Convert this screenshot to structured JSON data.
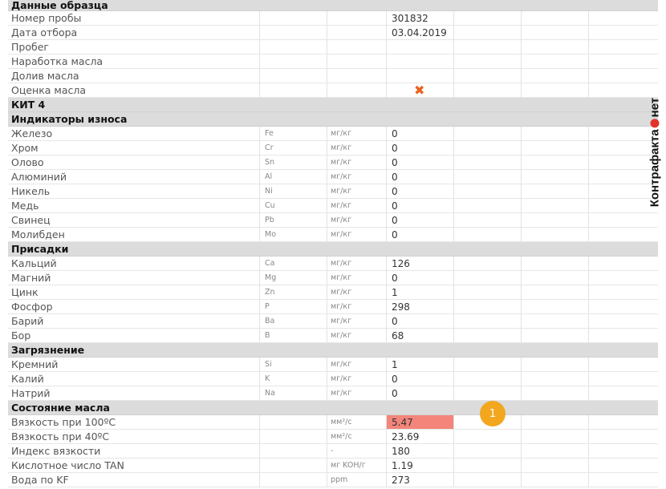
{
  "sample": {
    "header": "Данные образца",
    "rows": [
      {
        "name": "Номер пробы",
        "value": "301832"
      },
      {
        "name": "Дата отбора",
        "value": "03.04.2019"
      },
      {
        "name": "Пробег",
        "value": ""
      },
      {
        "name": "Наработка масла",
        "value": ""
      },
      {
        "name": "Долив масла",
        "value": ""
      },
      {
        "name": "Оценка масла",
        "value": "",
        "mark": "x"
      }
    ]
  },
  "kit_label": "КИТ 4",
  "sections": [
    {
      "title": "Индикаторы износа",
      "rows": [
        {
          "name": "Железо",
          "sym": "Fe",
          "unit": "мг/кг",
          "value": "0"
        },
        {
          "name": "Хром",
          "sym": "Cr",
          "unit": "мг/кг",
          "value": "0"
        },
        {
          "name": "Олово",
          "sym": "Sn",
          "unit": "мг/кг",
          "value": "0"
        },
        {
          "name": "Алюминий",
          "sym": "Al",
          "unit": "мг/кг",
          "value": "0"
        },
        {
          "name": "Никель",
          "sym": "Ni",
          "unit": "мг/кг",
          "value": "0"
        },
        {
          "name": "Медь",
          "sym": "Cu",
          "unit": "мг/кг",
          "value": "0"
        },
        {
          "name": "Свинец",
          "sym": "Pb",
          "unit": "мг/кг",
          "value": "0"
        },
        {
          "name": "Молибден",
          "sym": "Mo",
          "unit": "мг/кг",
          "value": "0"
        }
      ]
    },
    {
      "title": "Присадки",
      "rows": [
        {
          "name": "Кальций",
          "sym": "Ca",
          "unit": "мг/кг",
          "value": "126"
        },
        {
          "name": "Магний",
          "sym": "Mg",
          "unit": "мг/кг",
          "value": "0"
        },
        {
          "name": "Цинк",
          "sym": "Zn",
          "unit": "мг/кг",
          "value": "1"
        },
        {
          "name": "Фосфор",
          "sym": "P",
          "unit": "мг/кг",
          "value": "298"
        },
        {
          "name": "Барий",
          "sym": "Ba",
          "unit": "мг/кг",
          "value": "0"
        },
        {
          "name": "Бор",
          "sym": "B",
          "unit": "мг/кг",
          "value": "68"
        }
      ]
    },
    {
      "title": "Загрязнение",
      "rows": [
        {
          "name": "Кремний",
          "sym": "Si",
          "unit": "мг/кг",
          "value": "1"
        },
        {
          "name": "Калий",
          "sym": "K",
          "unit": "мг/кг",
          "value": "0"
        },
        {
          "name": "Натрий",
          "sym": "Na",
          "unit": "мг/кг",
          "value": "0"
        }
      ]
    },
    {
      "title": "Состояние масла",
      "rows": [
        {
          "name": "Вязкость при 100ºC",
          "sym": "",
          "unit": "мм²/с",
          "value": "5.47",
          "highlight": true
        },
        {
          "name": "Вязкость при 40ºC",
          "sym": "",
          "unit": "мм²/с",
          "value": "23.69"
        },
        {
          "name": "Индекс вязкости",
          "sym": "",
          "unit": "-",
          "value": "180"
        },
        {
          "name": "Кислотное число TAN",
          "sym": "",
          "unit": "мг KOH/г",
          "value": "1.19"
        },
        {
          "name": "Вода по KF",
          "sym": "",
          "unit": "ppm",
          "value": "273"
        }
      ]
    }
  ],
  "badge": "1",
  "brand": {
    "part1": "Контрафакта",
    "part2": "нет"
  },
  "colors": {
    "section_bg": "#dcdcdc",
    "highlight": "#f3857a",
    "badge": "#f2a71f",
    "cross": "#e8621e",
    "brand_dot": "#e2332b"
  }
}
